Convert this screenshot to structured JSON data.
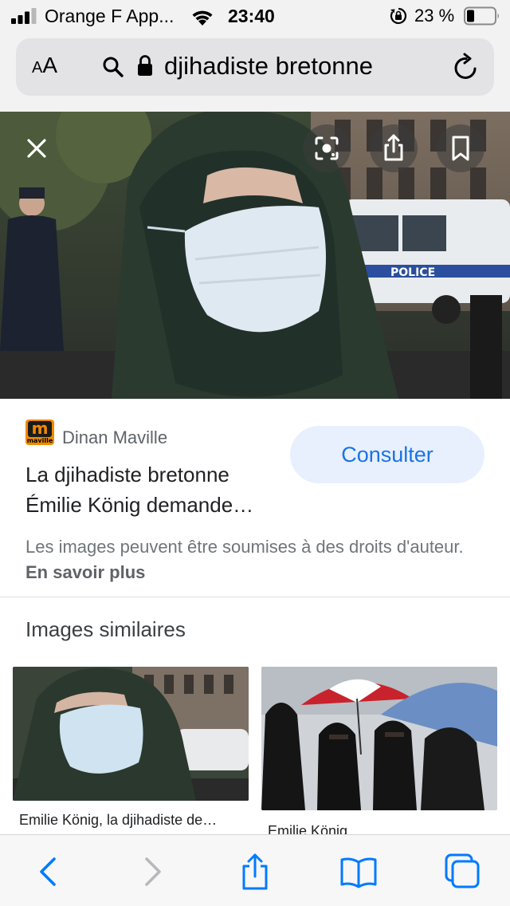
{
  "status_bar": {
    "carrier": "Orange F App...",
    "time": "23:40",
    "battery_percent": "23 %",
    "icons": [
      "signal-icon",
      "wifi-icon",
      "orientation-lock-icon",
      "battery-icon"
    ]
  },
  "address_bar": {
    "text_size_small": "A",
    "text_size_large": "A",
    "url": "djihadiste bretonne",
    "icons": [
      "search-icon",
      "padlock-icon",
      "reload-icon"
    ]
  },
  "hero": {
    "icons": [
      "close-icon",
      "google-lens-icon",
      "share-icon",
      "bookmark-icon"
    ],
    "scene_text": "POLICE"
  },
  "result": {
    "source_logo_letter": "m",
    "source_logo_text": "maville",
    "source": "Dinan Maville",
    "title_line1": "La djihadiste bretonne",
    "title_line2": "Émilie König demande…",
    "consult_label": "Consulter",
    "rights_text": "Les images peuvent être soumises à des droits d'auteur.",
    "learn_more": "En savoir plus"
  },
  "similar": {
    "heading": "Images similaires",
    "items": [
      {
        "caption": "Emilie König, la djihadiste de…"
      },
      {
        "caption": "Emilie König"
      }
    ]
  },
  "toolbar": {
    "icons": [
      "back-icon",
      "forward-icon",
      "share-icon",
      "bookmarks-icon",
      "tabs-icon"
    ]
  },
  "colors": {
    "accent": "#1a73e8",
    "button_bg": "#e8f0fe",
    "muted_text": "#70757a",
    "ios_blue": "#007aff"
  }
}
